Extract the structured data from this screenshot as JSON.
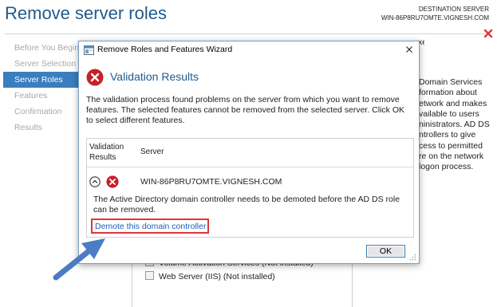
{
  "background": {
    "title": "Remove server roles",
    "destination_label": "DESTINATION SERVER",
    "destination_server": "WIN-86P8RU7OMTE.VIGNESH.COM",
    "nav": [
      {
        "label": "Before You Begin",
        "active": false
      },
      {
        "label": "Server Selection",
        "active": false
      },
      {
        "label": "Server Roles",
        "active": true
      },
      {
        "label": "Features",
        "active": false
      },
      {
        "label": "Confirmation",
        "active": false
      },
      {
        "label": "Results",
        "active": false
      }
    ],
    "top_text_tail": "xes.",
    "description_lines": [
      "Domain Services",
      "formation about",
      "etwork and makes",
      "vailable to users",
      "ninistrators. AD DS",
      "ntrollers to give",
      "cess to permitted",
      "re on the network",
      "logon process."
    ],
    "list_items": [
      {
        "label": "Volume Activation Services (Not installed)"
      },
      {
        "label": "Web Server (IIS) (Not installed)"
      }
    ]
  },
  "dialog": {
    "title": "Remove Roles and Features Wizard",
    "heading": "Validation Results",
    "message": "The validation process found problems on the server from which you want to remove features. The selected features cannot be removed from the selected server.  Click OK to select different features.",
    "columns": {
      "validation_line1": "Validation",
      "validation_line2": "Results",
      "server": "Server"
    },
    "result": {
      "server_name": "WIN-86P8RU7OMTE.VIGNESH.COM",
      "error_text": "The Active Directory domain controller needs to be demoted before the AD DS role can be removed.",
      "link_text": "Demote this domain controller"
    },
    "ok_label": "OK"
  },
  "colors": {
    "accent": "#1f5a8c",
    "error": "#c8202a",
    "highlight": "#e0343a",
    "link": "#1a62b8",
    "arrow": "#4c7cc3",
    "nav_active": "#3a7ec0"
  }
}
